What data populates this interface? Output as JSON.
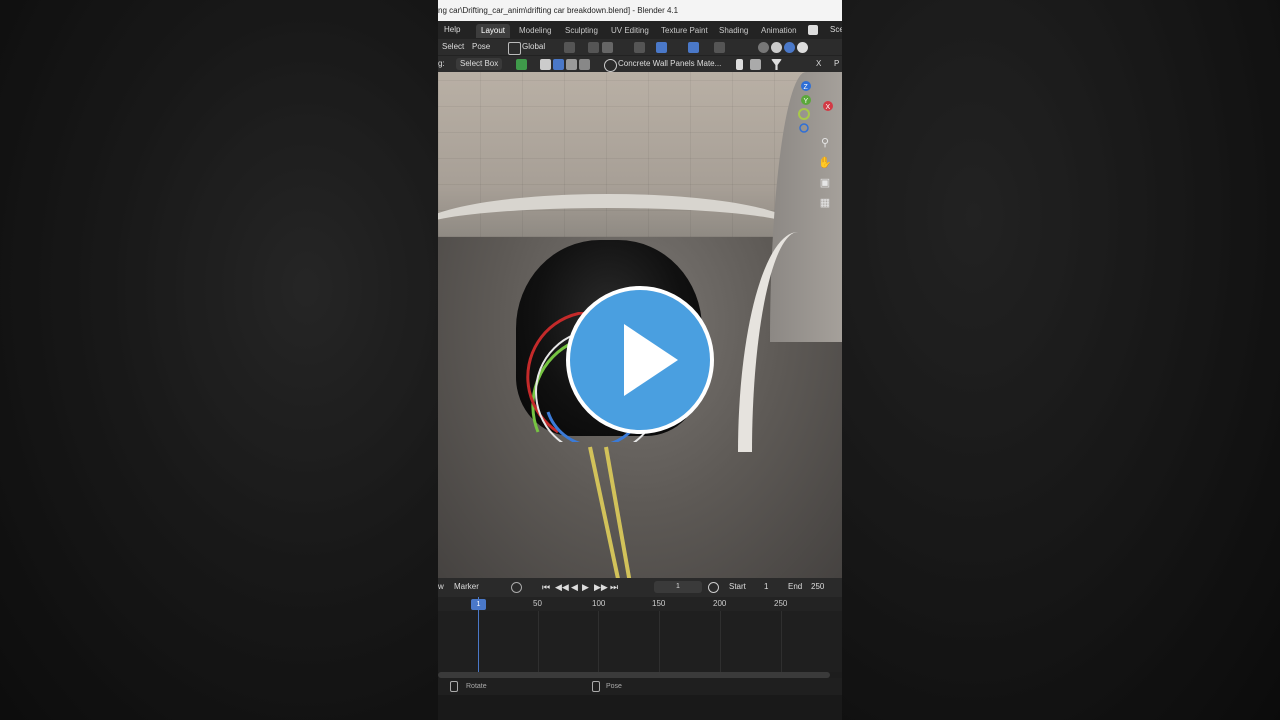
{
  "window": {
    "title": "ng car\\Drifting_car_anim\\drifting car breakdown.blend] - Blender 4.1"
  },
  "menubar": {
    "help": "Help",
    "workspaces": [
      "Layout",
      "Modeling",
      "Sculpting",
      "UV Editing",
      "Texture Paint",
      "Shading",
      "Animation"
    ],
    "active_workspace": "Layout",
    "scene_label": "Sce"
  },
  "header1": {
    "select": "Select",
    "pose": "Pose",
    "orientation": "Global"
  },
  "header2": {
    "tool_prefix": "g:",
    "tool": "Select Box",
    "material": "Concrete Wall Panels Mate...",
    "close": "X",
    "right": "P"
  },
  "viewport": {
    "gizmo_axes": [
      "Z",
      "Y",
      "X"
    ]
  },
  "timeline": {
    "view_label": "w",
    "marker": "Marker",
    "current_frame": "1",
    "start_label": "Start",
    "start": "1",
    "end_label": "End",
    "end": "250",
    "ruler": [
      "1",
      "50",
      "100",
      "150",
      "200",
      "250"
    ]
  },
  "statusbar": {
    "left": "Rotate",
    "mid": "Pose"
  },
  "colors": {
    "accent": "#4a78c8",
    "play_button": "#4a9fe0"
  }
}
